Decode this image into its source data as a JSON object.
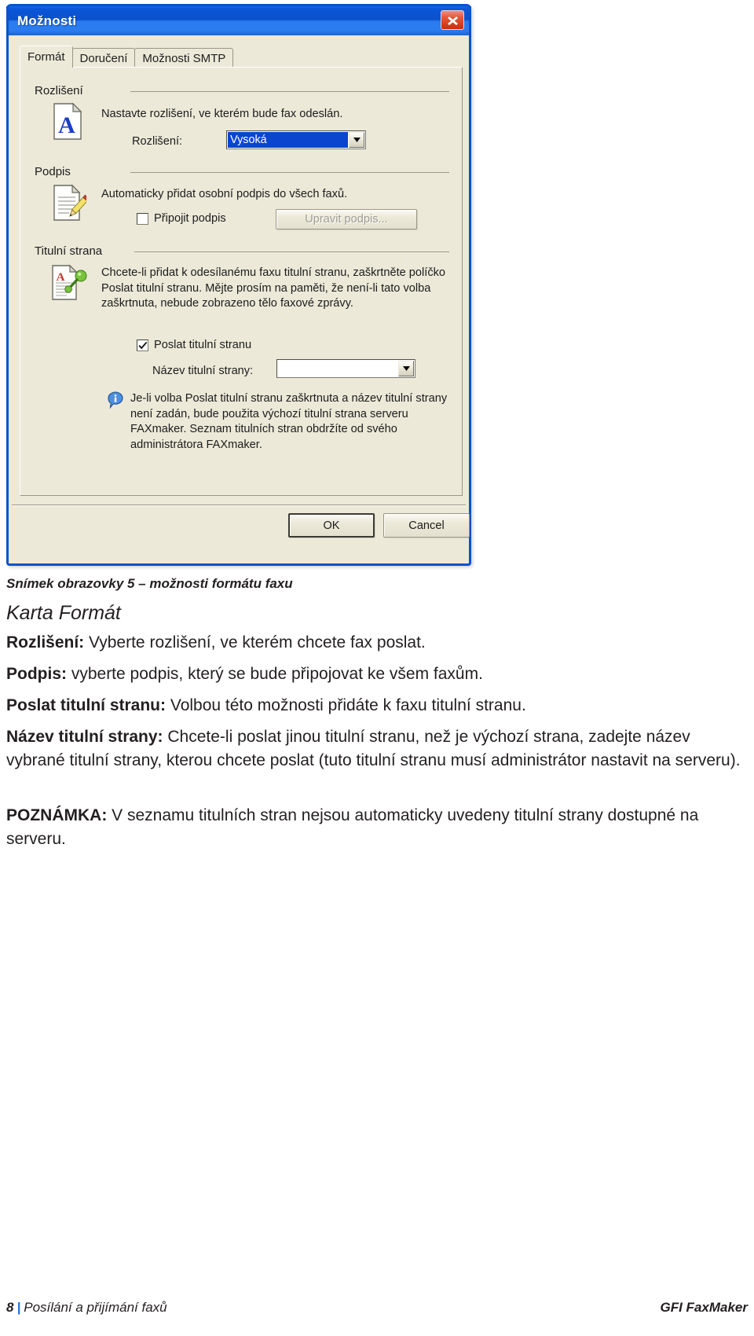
{
  "dialog": {
    "title": "Možnosti",
    "close_label": "×",
    "tabs": [
      {
        "label": "Formát",
        "selected": true
      },
      {
        "label": "Doručení",
        "selected": false
      },
      {
        "label": "Možnosti SMTP",
        "selected": false
      }
    ],
    "groups": {
      "resolution": {
        "legend": "Rozlišení",
        "description": "Nastavte rozlišení, ve kterém bude fax odeslán.",
        "field_label": "Rozlišení:",
        "field_value": "Vysoká"
      },
      "signature": {
        "legend": "Podpis",
        "description": "Automaticky přidat osobní podpis do všech faxů.",
        "checkbox_label": "Připojit podpis",
        "checkbox_checked": false,
        "button_label": "Upravit podpis...",
        "button_disabled": true
      },
      "coverpage": {
        "legend": "Titulní strana",
        "description": "Chcete-li přidat k odesílanému faxu titulní stranu, zaškrtněte políčko Poslat titulní stranu. Mějte prosím na paměti, že není-li tato volba zaškrtnuta, nebude zobrazeno tělo faxové zprávy.",
        "checkbox_label": "Poslat titulní stranu",
        "checkbox_checked": true,
        "field_label": "Název titulní strany:",
        "field_value": "",
        "note": "Je-li volba Poslat titulní stranu zaškrtnuta a název titulní strany není zadán, bude použita výchozí titulní strana serveru FAXmaker. Seznam titulních stran obdržíte od svého administrátora FAXmaker."
      }
    },
    "buttons": {
      "ok": "OK",
      "cancel": "Cancel"
    },
    "colors": {
      "titlebar_blue": "#0a52cc",
      "face": "#ece9d8",
      "highlight": "#0a45d0",
      "close_red": "#cc2d10"
    }
  },
  "document": {
    "caption": "Snímek obrazovky 5 – možnosti formátu faxu",
    "heading": "Karta Formát",
    "paragraphs": [
      {
        "term": "Rozlišení:",
        "text": " Vyberte rozlišení, ve kterém chcete fax poslat."
      },
      {
        "term": "Podpis:",
        "text": " vyberte podpis, který se bude připojovat ke všem faxům."
      },
      {
        "term": "Poslat titulní stranu:",
        "text": " Volbou této možnosti přidáte k faxu titulní stranu."
      },
      {
        "term": "Název titulní strany:",
        "text": " Chcete-li poslat jinou titulní stranu, než je výchozí strana, zadejte název vybrané titulní strany, kterou chcete poslat (tuto titulní stranu musí administrátor nastavit na serveru)."
      },
      {
        "term": "POZNÁMKA:",
        "text": " V seznamu titulních stran nejsou automaticky uvedeny titulní strany dostupné na serveru."
      }
    ],
    "footer": {
      "page_number": "8",
      "separator": "|",
      "section": "Posílání a přijímání faxů",
      "brand": "GFI FaxMaker"
    }
  }
}
